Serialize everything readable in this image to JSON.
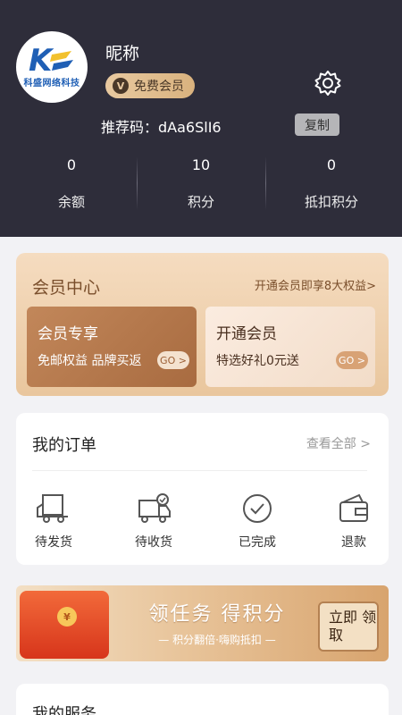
{
  "profile": {
    "nickname": "昵称",
    "member_level": "免费会员",
    "member_badge_glyph": "V",
    "avatar_logo_text": "科盛网络科技",
    "referral": "推荐码：dAa6SlI6",
    "copy_label": "复制"
  },
  "stats": [
    {
      "value": "0",
      "label": "余额"
    },
    {
      "value": "10",
      "label": "积分"
    },
    {
      "value": "0",
      "label": "抵扣积分"
    }
  ],
  "member_center": {
    "title": "会员中心",
    "link": "开通会员即享8大权益>",
    "card_exclusive": {
      "title": "会员专享",
      "subtitle": "免邮权益 品牌买返",
      "go": "GO >"
    },
    "card_join": {
      "title": "开通会员",
      "subtitle": "特选好礼0元送",
      "go": "GO >"
    }
  },
  "orders": {
    "title": "我的订单",
    "view_all": "查看全部 >",
    "items": [
      {
        "label": "待发货",
        "icon": "truck-box-icon"
      },
      {
        "label": "待收货",
        "icon": "truck-check-icon"
      },
      {
        "label": "已完成",
        "icon": "check-circle-icon"
      },
      {
        "label": "退款",
        "icon": "wallet-icon"
      }
    ]
  },
  "banner": {
    "headline": "领任务  得积分",
    "subline": "— 积分翻倍·嗨购抵扣 —",
    "button": "立即 领取",
    "coin_glyph": "¥"
  },
  "services": {
    "title": "我的服务"
  },
  "colors": {
    "header_bg": "#2e2d3a",
    "gold_accent": "#e8c9a0",
    "brown_text": "#7a4f2c"
  }
}
